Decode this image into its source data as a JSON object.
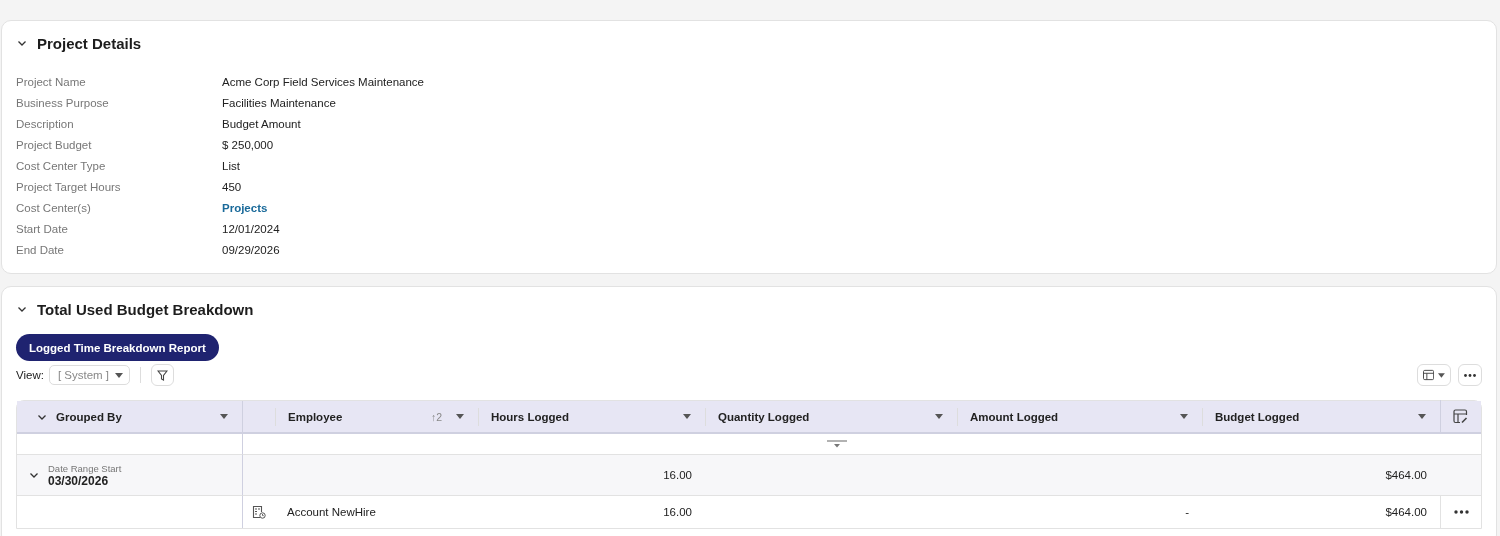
{
  "sections": [
    {
      "title": "Project Details",
      "expanded": true,
      "fields": [
        {
          "label": "Project Name",
          "value": "Acme Corp Field Services Maintenance",
          "kind": "text"
        },
        {
          "label": "Business Purpose",
          "value": "Facilities Maintenance",
          "kind": "text"
        },
        {
          "label": "Description",
          "value": "Budget Amount",
          "kind": "text"
        },
        {
          "label": "Project Budget",
          "value": "$ 250,000",
          "kind": "text"
        },
        {
          "label": "Cost Center Type",
          "value": "List",
          "kind": "text"
        },
        {
          "label": "Project Target Hours",
          "value": "450",
          "kind": "text"
        },
        {
          "label": "Cost Center(s)",
          "value": "Projects",
          "kind": "link"
        },
        {
          "label": "Start Date",
          "value": "12/01/2024",
          "kind": "text"
        },
        {
          "label": "End Date",
          "value": "09/29/2026",
          "kind": "text"
        }
      ]
    },
    {
      "title": "Total Used Budget Breakdown",
      "expanded": true,
      "report_button": "Logged Time Breakdown Report",
      "view": {
        "label": "View:",
        "value": "[ System ]"
      },
      "table": {
        "group_column": "Grouped By",
        "columns": [
          {
            "label": "Employee",
            "sort": "↑2"
          },
          {
            "label": "Hours Logged"
          },
          {
            "label": "Quantity Logged"
          },
          {
            "label": "Amount Logged"
          },
          {
            "label": "Budget Logged"
          }
        ],
        "rows": [
          {
            "kind": "group",
            "caption": "Date Range Start",
            "value": "03/30/2026",
            "expanded": true,
            "hours": "16.00",
            "budget": "$464.00"
          },
          {
            "kind": "item",
            "employee": "Account NewHire",
            "hours": "16.00",
            "amount": "-",
            "budget": "$464.00"
          }
        ]
      }
    }
  ]
}
